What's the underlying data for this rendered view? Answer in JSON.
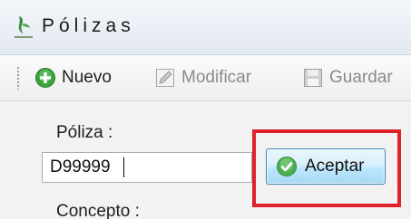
{
  "window": {
    "title": "Pólizas",
    "logo_icon": "green-leaf-logo-icon"
  },
  "toolbar": {
    "nuevo": {
      "label": "Nuevo",
      "icon": "add-circle-icon",
      "enabled": true
    },
    "modificar": {
      "label": "Modificar",
      "icon": "edit-icon",
      "enabled": false
    },
    "guardar": {
      "label": "Guardar",
      "icon": "save-icon",
      "enabled": false
    }
  },
  "form": {
    "poliza_label": "Póliza :",
    "poliza_value": "D99999",
    "aceptar_label": "Aceptar",
    "aceptar_icon": "check-circle-icon",
    "concepto_label": "Concepto :"
  },
  "colors": {
    "highlight": "#e0202a",
    "add_icon": "#3aa33a",
    "check_icon": "#4caf50",
    "button_border": "#3c7fb1"
  }
}
